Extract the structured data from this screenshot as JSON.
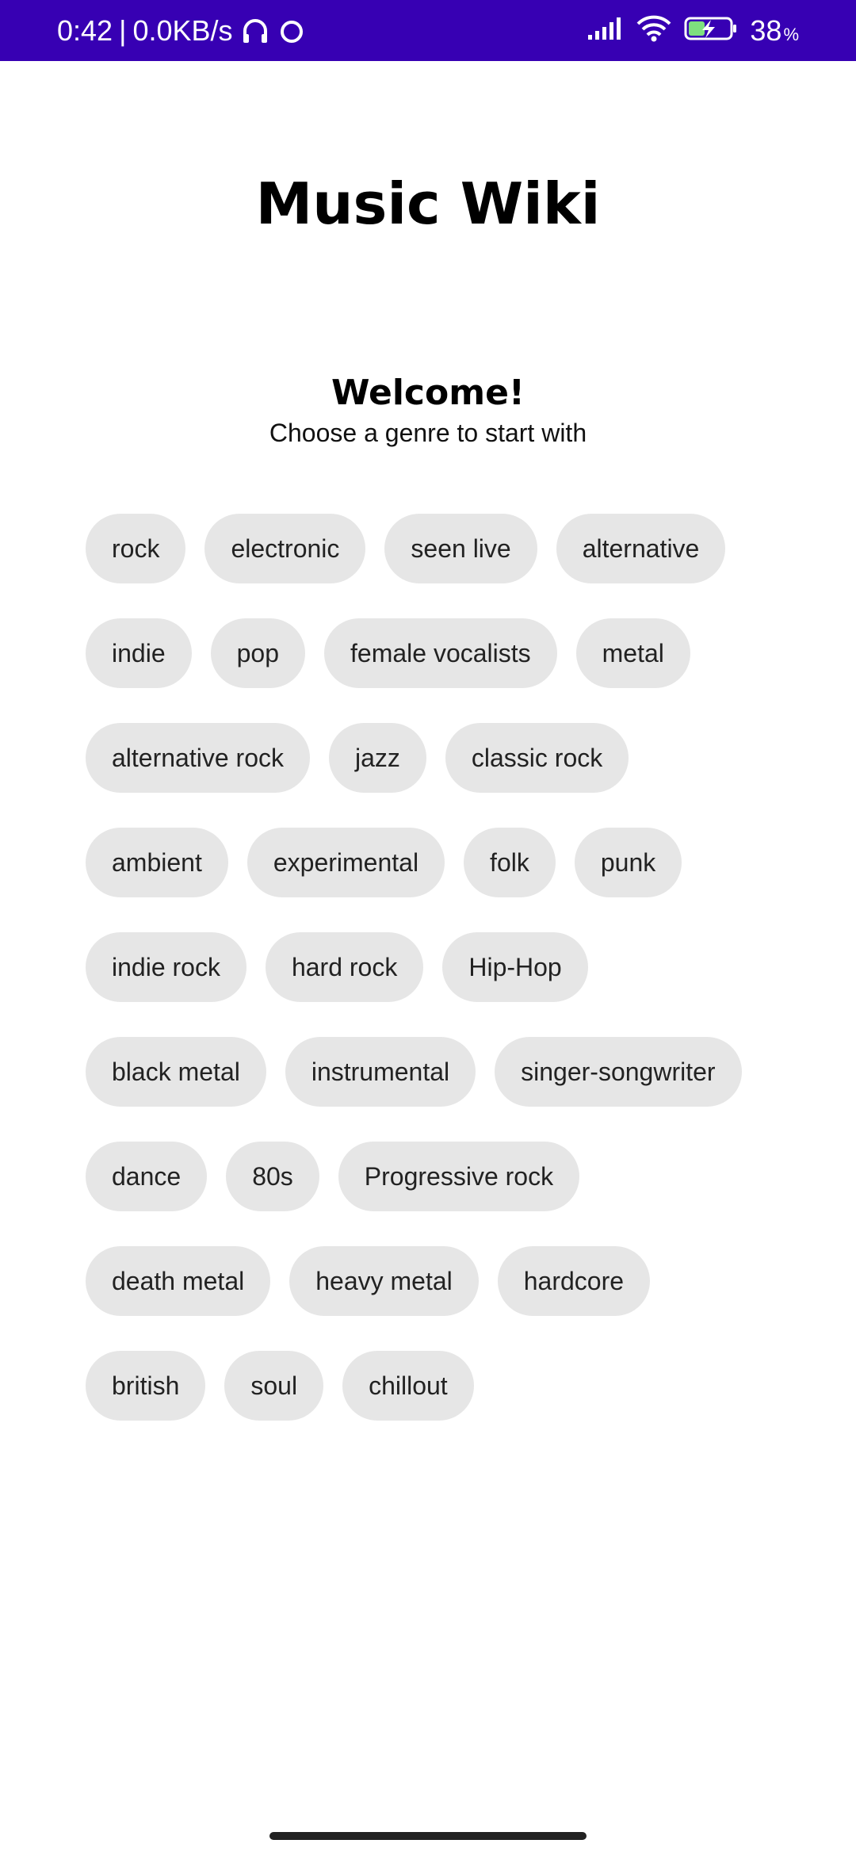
{
  "status_bar": {
    "time": "0:42",
    "separator": "|",
    "network_speed": "0.0KB/s",
    "battery_level": "38",
    "battery_unit": "%",
    "icons": [
      "headphones-icon",
      "circle-notification-icon",
      "signal-icon",
      "wifi-icon",
      "battery-charging-icon"
    ],
    "background_color": "#3700b3"
  },
  "app": {
    "title": "Music Wiki"
  },
  "welcome": {
    "title": "Welcome!",
    "subtitle": "Choose a genre to start with"
  },
  "genres": [
    "rock",
    "electronic",
    "seen live",
    "alternative",
    "indie",
    "pop",
    "female vocalists",
    "metal",
    "alternative rock",
    "jazz",
    "classic rock",
    "ambient",
    "experimental",
    "folk",
    "punk",
    "indie rock",
    "hard rock",
    "Hip-Hop",
    "black metal",
    "instrumental",
    "singer-songwriter",
    "dance",
    "80s",
    "Progressive rock",
    "death metal",
    "heavy metal",
    "hardcore",
    "british",
    "soul",
    "chillout"
  ],
  "colors": {
    "chip_background": "#e6e6e6",
    "chip_text": "#222222"
  }
}
